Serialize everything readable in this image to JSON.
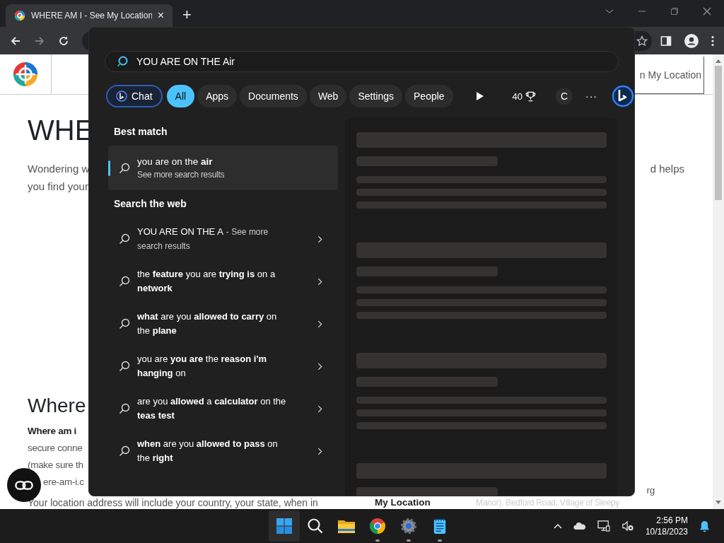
{
  "browser": {
    "tab": {
      "title": "WHERE AM I - See My Location",
      "close": "×"
    },
    "new_tab": "+",
    "forward_disabled": true
  },
  "page": {
    "nav_button": "n My Location",
    "heading": "WHE",
    "intro": [
      {
        "left": "Wondering w",
        "right": "d helps"
      },
      {
        "left": "you find your"
      }
    ],
    "section_heading": "Where",
    "section_lines": [
      {
        "text": "Where am i",
        "bold": true
      },
      {
        "text": "secure conne",
        "bold": false
      },
      {
        "text": "(make sure th",
        "bold": false
      },
      {
        "text": "ere-am-i.c",
        "bold": false
      }
    ],
    "side_note": "rg",
    "bottom_row": [
      {
        "text": "Your location address will include your country, your state, when in",
        "bold": false
      },
      {
        "text": "My Location",
        "bold": true
      },
      {
        "text": "Manor), Bedford Road, Village of Sleepy",
        "bold": false
      }
    ]
  },
  "search": {
    "value": "YOU ARE ON THE Air",
    "filters": [
      {
        "label": "Chat",
        "kind": "chat",
        "selected": false
      },
      {
        "label": "All",
        "kind": "chip",
        "selected": true
      },
      {
        "label": "Apps",
        "kind": "chip",
        "selected": false
      },
      {
        "label": "Documents",
        "kind": "chip",
        "selected": false
      },
      {
        "label": "Web",
        "kind": "chip",
        "selected": false
      },
      {
        "label": "Settings",
        "kind": "chip",
        "selected": false
      },
      {
        "label": "People",
        "kind": "chip",
        "selected": false
      }
    ],
    "points": "40",
    "avatar": "C",
    "more": "···",
    "best_match_label": "Best match",
    "best_match": {
      "title": "you are on the **air**",
      "subtitle": "See more search results",
      "selected": true
    },
    "web_label": "Search the web",
    "web_results": [
      {
        "text": "YOU ARE ON THE A",
        "suffix": "- See more search results"
      },
      {
        "text": "the **feature** you are **trying is** on a **network**"
      },
      {
        "text": "**what** are you **allowed to carry** on the **plane**"
      },
      {
        "text": "you are **you are** the **reason i'm hanging** on"
      },
      {
        "text": "are you **allowed** a **calculator** on the **teas test**"
      },
      {
        "text": "**when** are you **allowed to pass** on the **right**"
      }
    ]
  },
  "taskbar": {
    "apps": [
      {
        "kind": "start",
        "running": false
      },
      {
        "kind": "search",
        "running": false
      },
      {
        "kind": "files",
        "running": false
      },
      {
        "kind": "chrome",
        "running": true
      },
      {
        "kind": "settings",
        "running": true
      },
      {
        "kind": "notepad",
        "running": true
      }
    ],
    "time": "2:56 PM",
    "date": "10/18/2023"
  }
}
